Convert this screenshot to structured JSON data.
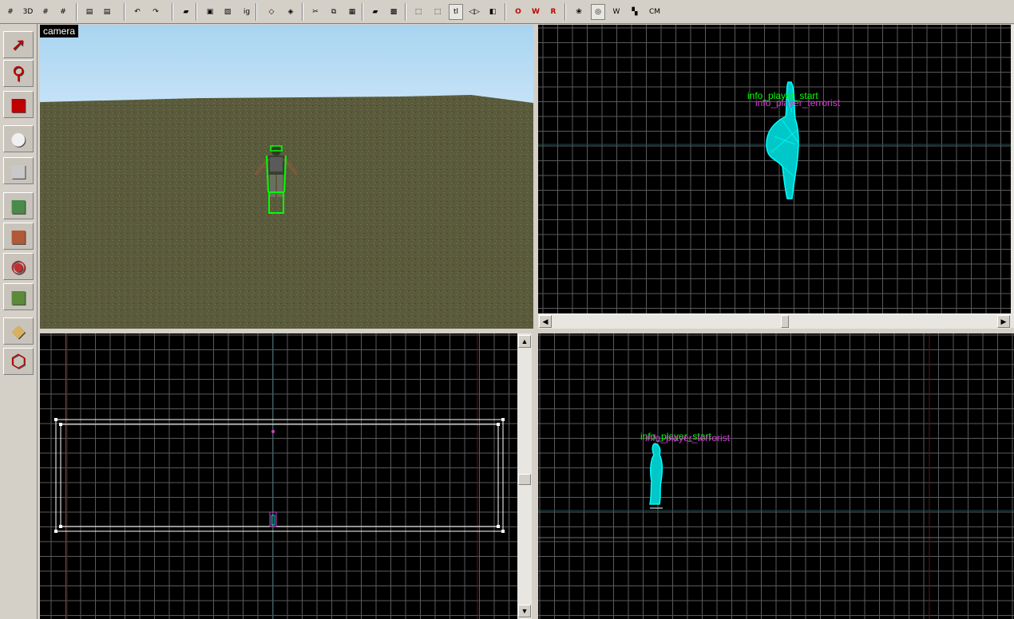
{
  "toolbar": {
    "buttons": [
      {
        "name": "grid-toggle-icon",
        "glyph": "#"
      },
      {
        "name": "3d-grid-icon",
        "glyph": "3D"
      },
      {
        "name": "smaller-grid-icon",
        "glyph": "#"
      },
      {
        "name": "larger-grid-icon",
        "glyph": "#"
      },
      {
        "name": "load-window-state-icon",
        "glyph": "▤"
      },
      {
        "name": "save-window-state-icon",
        "glyph": "▤"
      },
      {
        "name": "undo-icon",
        "glyph": "↶"
      },
      {
        "name": "redo-icon",
        "glyph": "↷"
      },
      {
        "name": "carve-icon",
        "glyph": "▰"
      },
      {
        "name": "group-icon",
        "glyph": "▣"
      },
      {
        "name": "ungroup-icon",
        "glyph": "▨"
      },
      {
        "name": "ignore-groups-icon",
        "glyph": "ig"
      },
      {
        "name": "hide-selected-icon",
        "glyph": "◇"
      },
      {
        "name": "hide-unselected-icon",
        "glyph": "◈"
      },
      {
        "name": "cut-icon",
        "glyph": "✂"
      },
      {
        "name": "copy-icon",
        "glyph": "⧉"
      },
      {
        "name": "paste-icon",
        "glyph": "▦"
      },
      {
        "name": "texture-lock-icon",
        "glyph": "▰"
      },
      {
        "name": "texture-scale-lock-icon",
        "glyph": "▩"
      },
      {
        "name": "select-icon",
        "glyph": "⬚"
      },
      {
        "name": "selection-toggle-icon",
        "glyph": "⬚"
      },
      {
        "name": "transform-icon",
        "glyph": "tl"
      },
      {
        "name": "flip-icon",
        "glyph": "◁▷"
      },
      {
        "name": "align-icon",
        "glyph": "◧"
      },
      {
        "name": "show-objects-icon",
        "glyph": "O"
      },
      {
        "name": "show-wireframe-icon",
        "glyph": "W"
      },
      {
        "name": "show-entities-icon",
        "glyph": "R"
      },
      {
        "name": "vertex-tool-icon",
        "glyph": "❀"
      },
      {
        "name": "polygon-view-icon",
        "glyph": "◎"
      },
      {
        "name": "texture-view-icon",
        "glyph": "W"
      },
      {
        "name": "flat-shaded-icon",
        "glyph": "▚"
      },
      {
        "name": "cordon-mode-icon",
        "glyph": "CM"
      }
    ]
  },
  "tools": [
    {
      "name": "selection-tool-icon",
      "glyph": "➚",
      "color": "#c00000"
    },
    {
      "name": "magnify-tool-icon",
      "glyph": "⚲",
      "color": "#c00000"
    },
    {
      "name": "camera-tool-icon",
      "glyph": "■",
      "color": "#c00000"
    },
    {
      "name": "entity-tool-icon",
      "glyph": "●",
      "color": "#f0f0f0"
    },
    {
      "name": "block-tool-icon",
      "glyph": "■",
      "color": "#c8c8c8"
    },
    {
      "name": "texture-application-tool-icon",
      "glyph": "■",
      "color": "#4a8a4a"
    },
    {
      "name": "apply-current-texture-icon",
      "glyph": "■",
      "color": "#b05a3a"
    },
    {
      "name": "decal-tool-icon",
      "glyph": "◉",
      "color": "#c03030"
    },
    {
      "name": "overlay-tool-icon",
      "glyph": "■",
      "color": "#5a8a3a"
    },
    {
      "name": "clipping-tool-icon",
      "glyph": "◆",
      "color": "#d8b060"
    },
    {
      "name": "vertex-manipulation-tool-icon",
      "glyph": "⬡",
      "color": "#c00000"
    }
  ],
  "viewports": {
    "camera": {
      "label": "camera"
    },
    "top": {
      "entity_label_1": "info_player_start",
      "entity_label_2": "info_player_terrorist"
    },
    "side": {
      "entity_label_1": "info_player_start",
      "entity_label_2": "info_player_terrorist"
    }
  },
  "colors": {
    "grid": "#3c3c3c",
    "grid_major": "#5a5a5a",
    "selection": "#00ffff",
    "label_green": "#00ff00",
    "label_magenta": "#d040d0"
  }
}
